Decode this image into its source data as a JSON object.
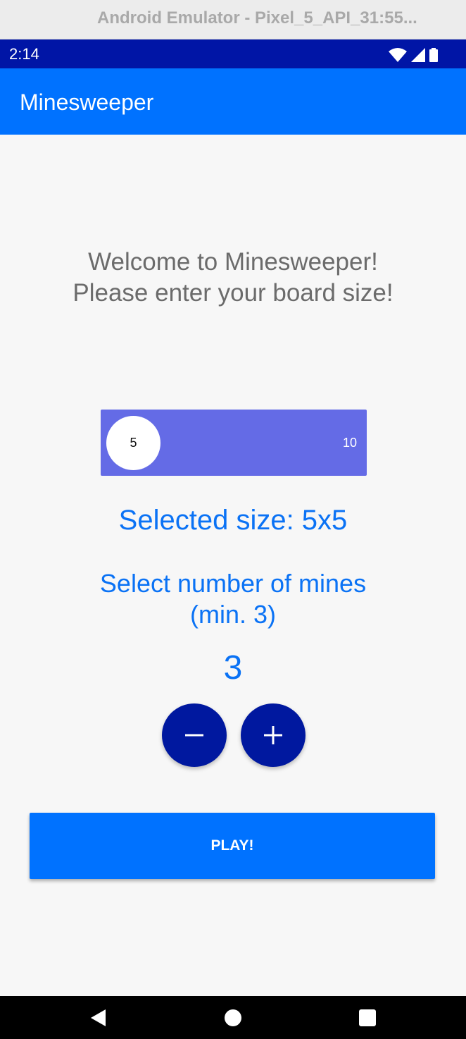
{
  "window": {
    "title": "Android Emulator - Pixel_5_API_31:55..."
  },
  "status_bar": {
    "time": "2:14",
    "icons": [
      "wifi-icon",
      "cell-signal-icon",
      "battery-icon"
    ],
    "background": "#0015a6"
  },
  "app_bar": {
    "title": "Minesweeper",
    "background": "#0072ff"
  },
  "welcome": {
    "line1": "Welcome to Minesweeper!",
    "line2": "Please enter your board size!"
  },
  "size_slider": {
    "value": "5",
    "max_label": "10",
    "color": "#646be6"
  },
  "selected_size": {
    "text": "Selected size: 5x5"
  },
  "mines": {
    "prompt_line1": "Select number of mines",
    "prompt_line2": "(min. 3)",
    "count": "3",
    "decrement_icon": "minus-icon",
    "increment_icon": "plus-icon"
  },
  "play_button": {
    "label": "PLAY!"
  },
  "nav_bar": {
    "icons": [
      "back-icon",
      "home-icon",
      "recents-icon"
    ]
  },
  "colors": {
    "accent": "#0a72f5",
    "round_button": "#00189f"
  }
}
